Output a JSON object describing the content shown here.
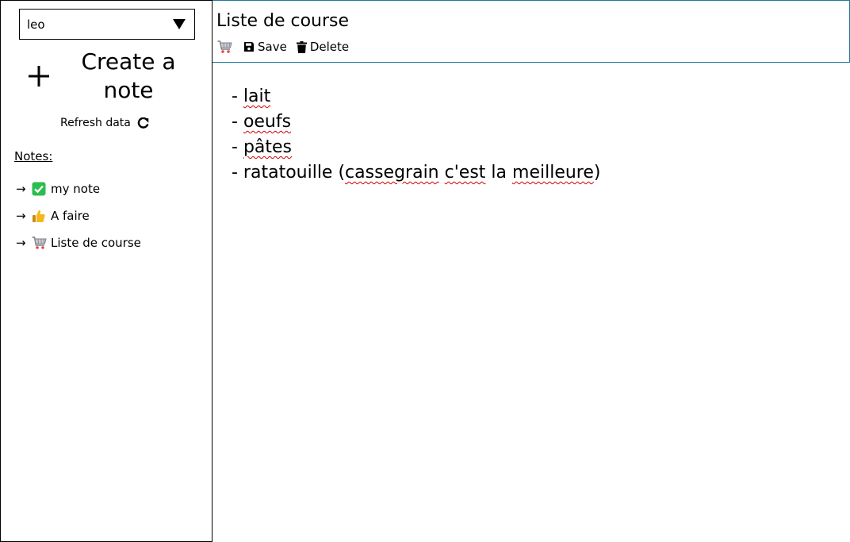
{
  "sidebar": {
    "user_select": {
      "value": "leo"
    },
    "create_note_label": "Create a note",
    "refresh_label": "Refresh data",
    "notes_title": "Notes:",
    "notes": [
      {
        "arrow": "→",
        "icon": "check-mark-icon",
        "label": "my note"
      },
      {
        "arrow": "→",
        "icon": "thumbs-up-icon",
        "label": "A faire"
      },
      {
        "arrow": "→",
        "icon": "shopping-cart-icon",
        "label": "Liste de course"
      }
    ]
  },
  "editor": {
    "title": "Liste de course",
    "toolbar": {
      "emoji_icon": "shopping-cart-icon",
      "save_label": "Save",
      "delete_label": "Delete"
    },
    "content": {
      "line1_prefix": "- ",
      "line1_word": "lait",
      "line2_prefix": "- ",
      "line2_word": "oeufs",
      "line3_prefix": "- ",
      "line3_word": "pâtes",
      "line4_prefix": "- ratatouille (",
      "line4_word1": "cassegrain",
      "line4_space": " ",
      "line4_word2": "c'est",
      "line4_mid": " la ",
      "line4_word3": "meilleure",
      "line4_suffix": ")"
    }
  },
  "colors": {
    "header_border": "#1a7aa0",
    "check_green": "#2dbd4e",
    "thumb_yellow": "#f5b81c",
    "spellcheck_red": "#d00000"
  }
}
